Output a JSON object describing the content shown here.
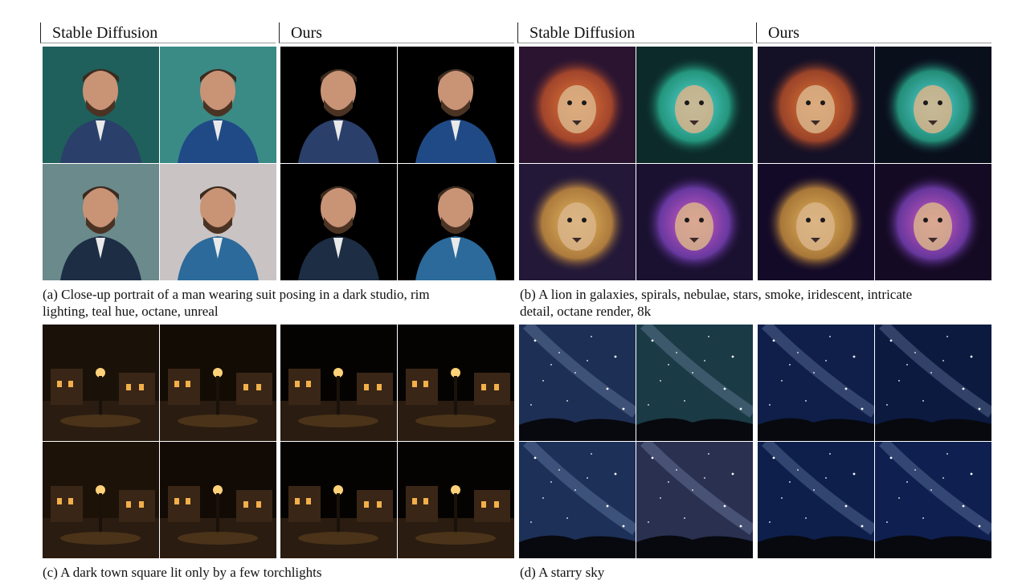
{
  "headers": {
    "left_sd": "Stable Diffusion",
    "left_ours": "Ours",
    "right_sd": "Stable Diffusion",
    "right_ours": "Ours"
  },
  "captions": {
    "a_line1": "(a) Close-up portrait of a man wearing suit posing in a dark studio, rim",
    "a_line2": "lighting, teal hue, octane, unreal",
    "b_line1": "(b) A lion in galaxies, spirals, nebulae, stars, smoke, iridescent, intricate",
    "b_line2": "detail, octane render, 8k",
    "c_line1": "(c) A dark town square lit only by a few torchlights",
    "d_line1": "(d) A starry sky"
  },
  "image_groups": [
    {
      "name": "portrait-stable-diffusion",
      "theme": "portrait",
      "bg": [
        "#1f5f5c",
        "#3a8a86",
        "#6a8a8c",
        "#c9c3c4"
      ]
    },
    {
      "name": "portrait-ours",
      "theme": "portrait",
      "bg": [
        "#000000",
        "#000000",
        "#000000",
        "#000000"
      ]
    },
    {
      "name": "lion-stable-diffusion",
      "theme": "lion",
      "bg": [
        "#2a1430",
        "#0c2a2a",
        "#231838",
        "#1a1030"
      ]
    },
    {
      "name": "lion-ours",
      "theme": "lion",
      "bg": [
        "#141026",
        "#0a0f1c",
        "#130a28",
        "#150a24"
      ]
    },
    {
      "name": "town-stable-diffusion",
      "theme": "town",
      "bg": [
        "#1a1208",
        "#120c05",
        "#1c1208",
        "#120a05"
      ]
    },
    {
      "name": "town-ours",
      "theme": "town",
      "bg": [
        "#050302",
        "#050302",
        "#050302",
        "#050302"
      ]
    },
    {
      "name": "sky-stable-diffusion",
      "theme": "sky",
      "bg": [
        "#1e2f55",
        "#1a3a45",
        "#1c3058",
        "#2a3050"
      ]
    },
    {
      "name": "sky-ours",
      "theme": "sky",
      "bg": [
        "#0f1f4a",
        "#0c1a40",
        "#0e1f4c",
        "#0f2050"
      ]
    }
  ]
}
